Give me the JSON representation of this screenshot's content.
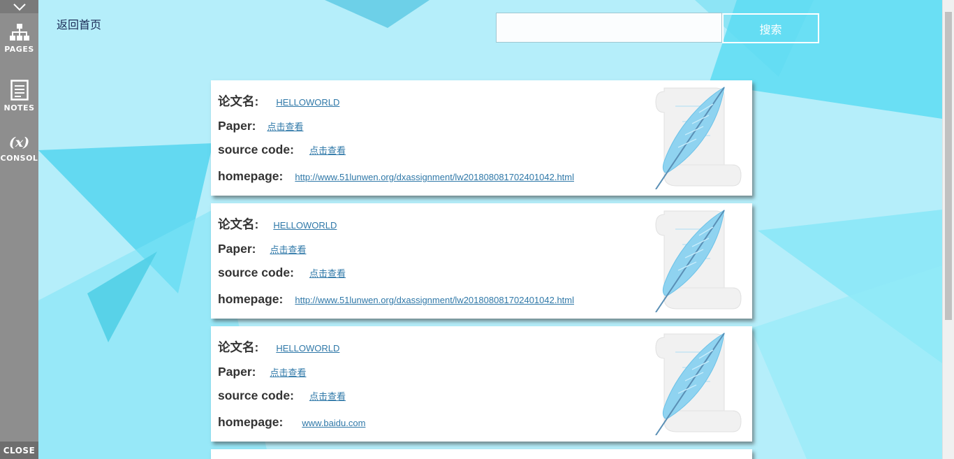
{
  "sidebar": {
    "items": [
      {
        "label": "PAGES",
        "icon": "sitemap-icon"
      },
      {
        "label": "NOTES",
        "icon": "notes-icon"
      },
      {
        "label": "CONSOL",
        "icon": "variable-x-icon",
        "glyph": "(x)"
      }
    ],
    "close_label": "CLOSE"
  },
  "header": {
    "home_link": "返回首页",
    "search_placeholder": "",
    "search_value": "",
    "search_button": "搜索"
  },
  "labels": {
    "title": "论文名:",
    "paper": "Paper:",
    "source_code": "source code:",
    "homepage": "homepage:"
  },
  "papers": [
    {
      "title": "HELLOWORLD",
      "paper": "点击查看",
      "source_code": "点击查看",
      "homepage": "http://www.51lunwen.org/dxassignment/lw201808081702401042.html"
    },
    {
      "title": "HELLOWORLD",
      "paper": "点击查看",
      "source_code": "点击查看",
      "homepage": "http://www.51lunwen.org/dxassignment/lw201808081702401042.html"
    },
    {
      "title": "HELLOWORLD",
      "paper": "点击查看",
      "source_code": "点击查看",
      "homepage": "www.baidu.com"
    }
  ],
  "colors": {
    "background": "#b5eefa",
    "sidebar": "#8e8e8e",
    "link": "#2f78a8",
    "feather": "#8fd3f0"
  }
}
